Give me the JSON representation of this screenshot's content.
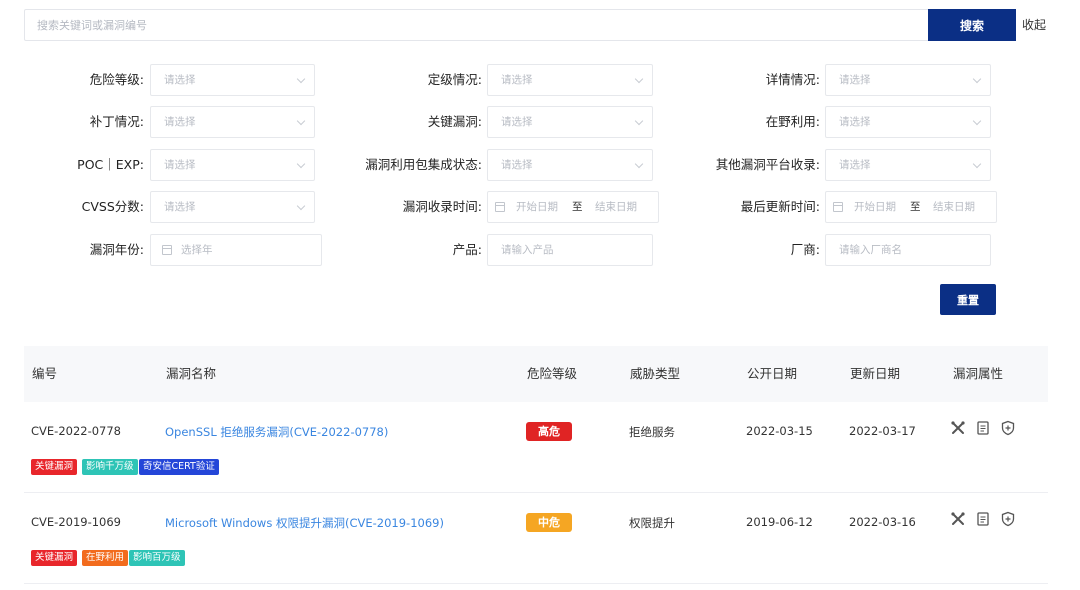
{
  "search": {
    "placeholder": "搜索关键词或漏洞编号",
    "button": "搜索",
    "collapse": "收起"
  },
  "filters": {
    "risk_level": {
      "label": "危险等级:",
      "placeholder": "请选择"
    },
    "rating": {
      "label": "定级情况:",
      "placeholder": "请选择"
    },
    "details": {
      "label": "详情情况:",
      "placeholder": "请选择"
    },
    "patch": {
      "label": "补丁情况:",
      "placeholder": "请选择"
    },
    "key_vuln": {
      "label": "关键漏洞:",
      "placeholder": "请选择"
    },
    "in_the_wild": {
      "label": "在野利用:",
      "placeholder": "请选择"
    },
    "poc_exp": {
      "label": "POC｜EXP:",
      "placeholder": "请选择"
    },
    "exploit_pkg": {
      "label": "漏洞利用包集成状态:",
      "placeholder": "请选择"
    },
    "other_platform": {
      "label": "其他漏洞平台收录:",
      "placeholder": "请选择"
    },
    "cvss": {
      "label": "CVSS分数:",
      "placeholder": "请选择"
    },
    "collected_time": {
      "label": "漏洞收录时间:",
      "start": "开始日期",
      "to": "至",
      "end": "结束日期"
    },
    "updated_time": {
      "label": "最后更新时间:",
      "start": "开始日期",
      "to": "至",
      "end": "结束日期"
    },
    "year": {
      "label": "漏洞年份:",
      "placeholder": "选择年"
    },
    "product": {
      "label": "产品:",
      "placeholder": "请输入产品"
    },
    "vendor": {
      "label": "厂商:",
      "placeholder": "请输入厂商名"
    },
    "reset": "重置"
  },
  "table": {
    "columns": [
      "编号",
      "漏洞名称",
      "危险等级",
      "威胁类型",
      "公开日期",
      "更新日期",
      "漏洞属性"
    ],
    "rows": [
      {
        "id": "CVE-2022-0778",
        "name": "OpenSSL 拒绝服务漏洞(CVE-2022-0778)",
        "level": "高危",
        "level_color": "#e02424",
        "threat": "拒绝服务",
        "published": "2022-03-15",
        "updated": "2022-03-17",
        "tags": [
          {
            "text": "关键漏洞",
            "color": "#e8262b"
          },
          {
            "text": "影响千万级",
            "color": "#2ec4b6"
          },
          {
            "text": "奇安信CERT验证",
            "color": "#2446d8"
          }
        ]
      },
      {
        "id": "CVE-2019-1069",
        "name": "Microsoft Windows 权限提升漏洞(CVE-2019-1069)",
        "level": "中危",
        "level_color": "#f5a623",
        "threat": "权限提升",
        "published": "2019-06-12",
        "updated": "2022-03-16",
        "tags": [
          {
            "text": "关键漏洞",
            "color": "#e8262b"
          },
          {
            "text": "在野利用",
            "color": "#f26b1d"
          },
          {
            "text": "影响百万级",
            "color": "#2ec4b6"
          }
        ]
      }
    ],
    "attribute_icons": [
      "tools-icon",
      "document-icon",
      "shield-icon"
    ]
  }
}
